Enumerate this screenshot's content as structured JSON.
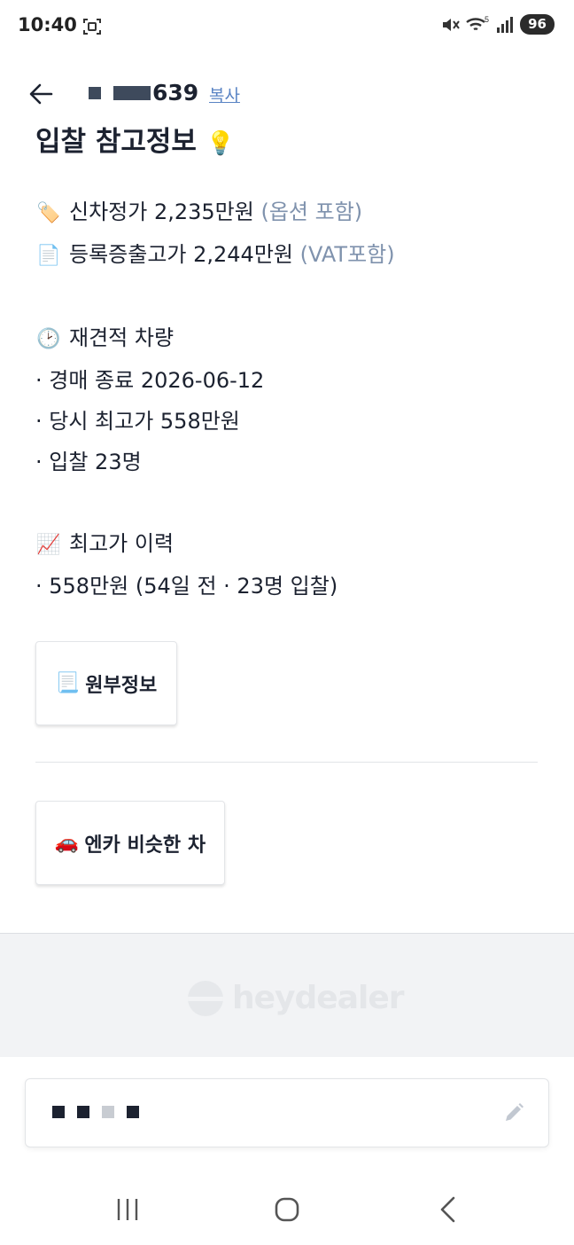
{
  "status_bar": {
    "time": "10:40",
    "battery": "96",
    "icons": [
      "screen-capture-icon",
      "mute-icon",
      "wifi-icon",
      "signal-icon"
    ]
  },
  "header": {
    "plate_suffix": "639",
    "copy_label": "복사"
  },
  "content": {
    "section_title": "입찰 참고정보",
    "price_new": {
      "emoji": "🏷️",
      "text": "신차정가 2,235만원",
      "note": "(옵션 포함)"
    },
    "price_registered": {
      "emoji": "📄",
      "text": "등록증출고가 2,244만원",
      "note": "(VAT포함)"
    },
    "requote": {
      "emoji": "🕑",
      "title": "재견적 차량",
      "items": [
        "· 경매 종료 2026-06-12",
        "· 당시 최고가 558만원",
        "· 입찰 23명"
      ]
    },
    "history": {
      "emoji": "📈",
      "title": "최고가 이력",
      "items": [
        "· 558만원 (54일 전 · 23명 입찰)"
      ]
    }
  },
  "buttons": {
    "ledger": {
      "emoji": "📃",
      "label": "원부정보"
    },
    "encar": {
      "emoji": "🚗",
      "label": "엔카 비슷한 차"
    }
  },
  "footer": {
    "logo_text": "heydealer"
  },
  "colors": {
    "accent_link": "#5a84c4",
    "muted": "#7f92ad",
    "text": "#1c2230"
  }
}
